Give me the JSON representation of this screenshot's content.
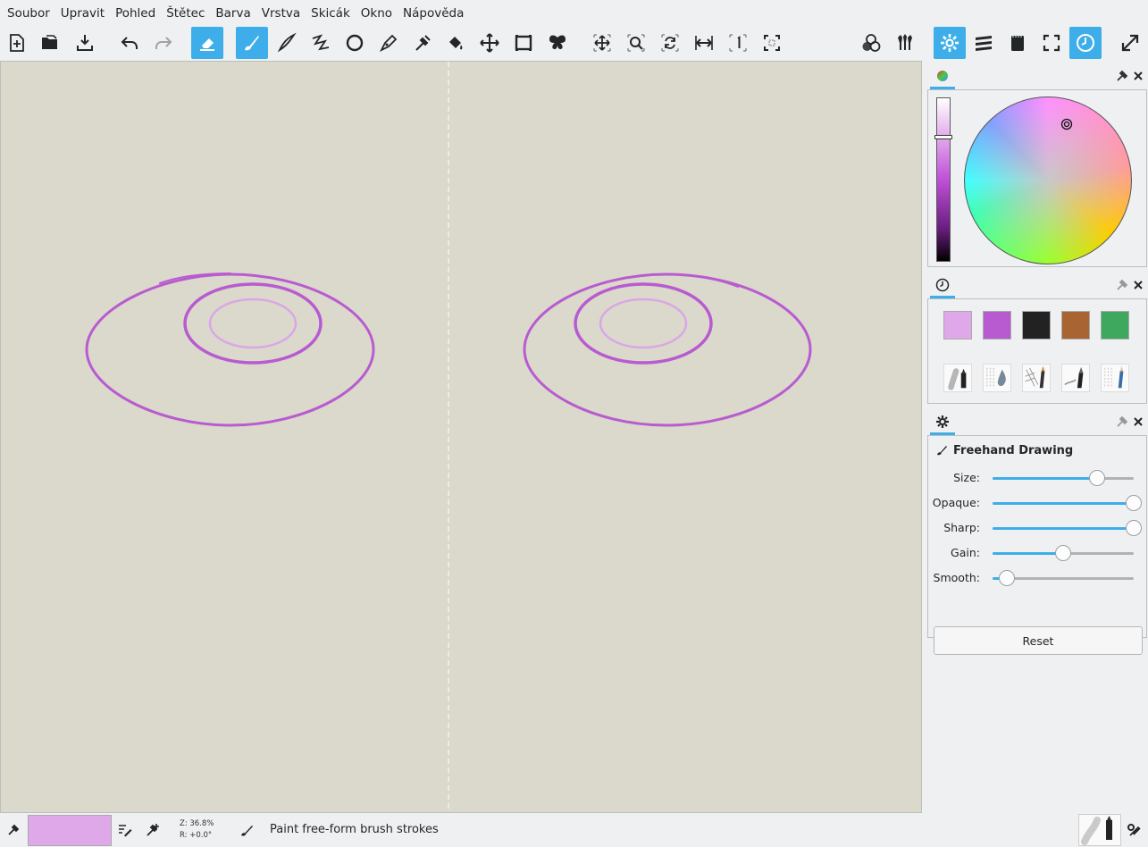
{
  "menu": [
    "Soubor",
    "Upravit",
    "Pohled",
    "Štětec",
    "Barva",
    "Vrstva",
    "Skicák",
    "Okno",
    "Nápověda"
  ],
  "toolbar": {
    "left_tools": [
      {
        "name": "new-document-icon",
        "active": false
      },
      {
        "name": "open-file-icon",
        "active": false
      },
      {
        "name": "save-icon",
        "active": false
      },
      {
        "name": "undo-icon",
        "active": false
      },
      {
        "name": "redo-icon",
        "active": false
      },
      {
        "name": "eraser-icon",
        "active": true
      },
      {
        "name": "freehand-brush-icon",
        "active": true
      },
      {
        "name": "inking-icon",
        "active": false
      },
      {
        "name": "connected-lines-icon",
        "active": false
      },
      {
        "name": "ellipse-icon",
        "active": false
      },
      {
        "name": "pen-icon",
        "active": false
      },
      {
        "name": "color-picker-icon",
        "active": false
      },
      {
        "name": "fill-icon",
        "active": false
      },
      {
        "name": "move-layer-icon",
        "active": false
      },
      {
        "name": "frame-icon",
        "active": false
      },
      {
        "name": "symmetry-icon",
        "active": false
      }
    ],
    "view_tools": [
      "pan-view-icon",
      "zoom-view-icon",
      "rotate-view-icon",
      "mirror-view-icon",
      "reset-zoom-icon",
      "fit-view-icon"
    ],
    "right_tools": [
      {
        "name": "color-mix-icon",
        "active": false
      },
      {
        "name": "brushes-icon",
        "active": false
      },
      {
        "name": "tool-options-icon",
        "active": true
      },
      {
        "name": "layers-icon",
        "active": false
      },
      {
        "name": "scratchpad-icon",
        "active": false
      },
      {
        "name": "fullscreen-icon",
        "active": false
      },
      {
        "name": "history-icon",
        "active": true
      },
      {
        "name": "expand-icon",
        "active": false
      }
    ]
  },
  "colors": {
    "accent": "#3daee9",
    "canvas": "#dad9cc",
    "stroke_main": "#b95bd0",
    "stroke_light": "#dba6e6"
  },
  "panels": {
    "color": {
      "tab_icon": "color-wheel-icon"
    },
    "history": {
      "tab_icon": "clock-icon",
      "swatches": [
        "#dfa8e8",
        "#b95bd0",
        "#222222",
        "#a86433",
        "#3ea85e"
      ],
      "brushes": [
        "airbrush-marker",
        "water-drop",
        "pencil-crosshatch",
        "ink-pen",
        "blue-pencil"
      ]
    },
    "tool_options": {
      "tab_icon": "gear-icon",
      "title": "Freehand Drawing",
      "sliders": [
        {
          "label": "Size:",
          "value": 0.74
        },
        {
          "label": "Opaque:",
          "value": 1.0
        },
        {
          "label": "Sharp:",
          "value": 1.0
        },
        {
          "label": "Gain:",
          "value": 0.5
        },
        {
          "label": "Smooth:",
          "value": 0.1
        }
      ],
      "reset_label": "Reset"
    }
  },
  "status": {
    "current_color": "#dfa8e8",
    "zoom": "Z: 36.8%",
    "rotation": "R: +0.0°",
    "message": "Paint free-form brush strokes"
  }
}
